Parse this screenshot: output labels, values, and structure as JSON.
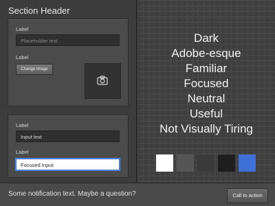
{
  "left": {
    "section_header": "Section Header",
    "panel1": {
      "label1": "Label",
      "placeholder": "Placeholder text",
      "label2": "Label",
      "change_image_label": "Change Image",
      "image_icon": "camera-icon"
    },
    "panel2": {
      "label1": "Label",
      "input_value": "Input text",
      "label2": "Label",
      "focused_value": "Focused Input"
    }
  },
  "right": {
    "words": [
      "Dark",
      "Adobe-esque",
      "Familiar",
      "Focused",
      "Neutral",
      "Useful",
      "Not Visually Tiring"
    ],
    "swatches": [
      "#ffffff",
      "#555555",
      "#3a3a3a",
      "#1e1e1e",
      "#3f70d6"
    ]
  },
  "notification": {
    "text": "Some notification text. Maybe a question?",
    "cta_label": "Call to action"
  }
}
